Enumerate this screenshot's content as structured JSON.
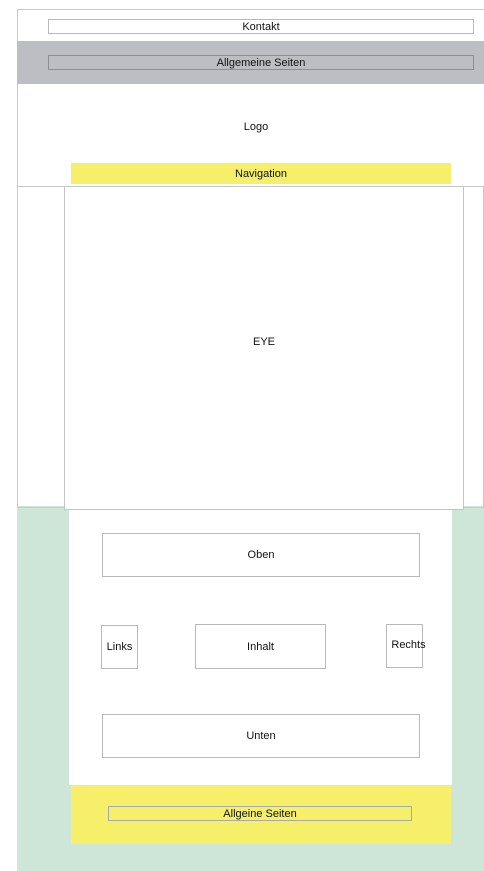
{
  "colors": {
    "gray_band": "#bcbec3",
    "yellow": "#f6ef6a",
    "green": "#cde6d8",
    "box_border": "#b9b9b9"
  },
  "header": {
    "contact_label": "Kontakt",
    "general_pages_label": "Allgemeine Seiten"
  },
  "branding": {
    "logo_label": "Logo",
    "navigation_label": "Navigation"
  },
  "hero": {
    "eye_label": "EYE"
  },
  "content": {
    "top_label": "Oben",
    "left_label": "Links",
    "main_label": "Inhalt",
    "right_label": "Rechts",
    "bottom_label": "Unten"
  },
  "footer": {
    "general_pages_label": "Allgeine Seiten"
  }
}
